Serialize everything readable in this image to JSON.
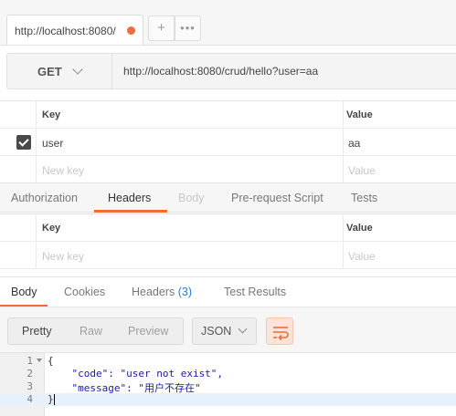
{
  "request_tabs": {
    "active_tab_label": "http://localhost:8080/",
    "add_label": "+",
    "more_label": "•••"
  },
  "request": {
    "method": "GET",
    "url": "http://localhost:8080/crud/hello?user=aa"
  },
  "params": {
    "key_header": "Key",
    "value_header": "Value",
    "rows": [
      {
        "key": "user",
        "value": "aa",
        "checked": true
      }
    ],
    "new_key_placeholder": "New key",
    "new_value_placeholder": "Value"
  },
  "request_section_tabs": {
    "items": [
      "Authorization",
      "Headers",
      "Body",
      "Pre-request Script",
      "Tests"
    ],
    "active": "Headers",
    "disabled": [
      "Body"
    ]
  },
  "headers_table": {
    "key_header": "Key",
    "value_header": "Value",
    "new_key_placeholder": "New key",
    "new_value_placeholder": "Value"
  },
  "response_tabs": {
    "body": "Body",
    "cookies": "Cookies",
    "headers": "Headers",
    "headers_count": "(3)",
    "test_results": "Test Results",
    "active": "Body"
  },
  "response_toolbar": {
    "view_modes": [
      "Pretty",
      "Raw",
      "Preview"
    ],
    "active_view": "Pretty",
    "format": "JSON"
  },
  "response_body": {
    "line_numbers": [
      "1",
      "2",
      "3",
      "4"
    ],
    "lines": [
      "{",
      "    \"code\": \"user not exist\",",
      "    \"message\": \"用户不存在\"",
      "}"
    ]
  },
  "colors": {
    "accent": "#f26b3a",
    "link": "#2a7bd3",
    "current_line": "#e8f1fb"
  }
}
